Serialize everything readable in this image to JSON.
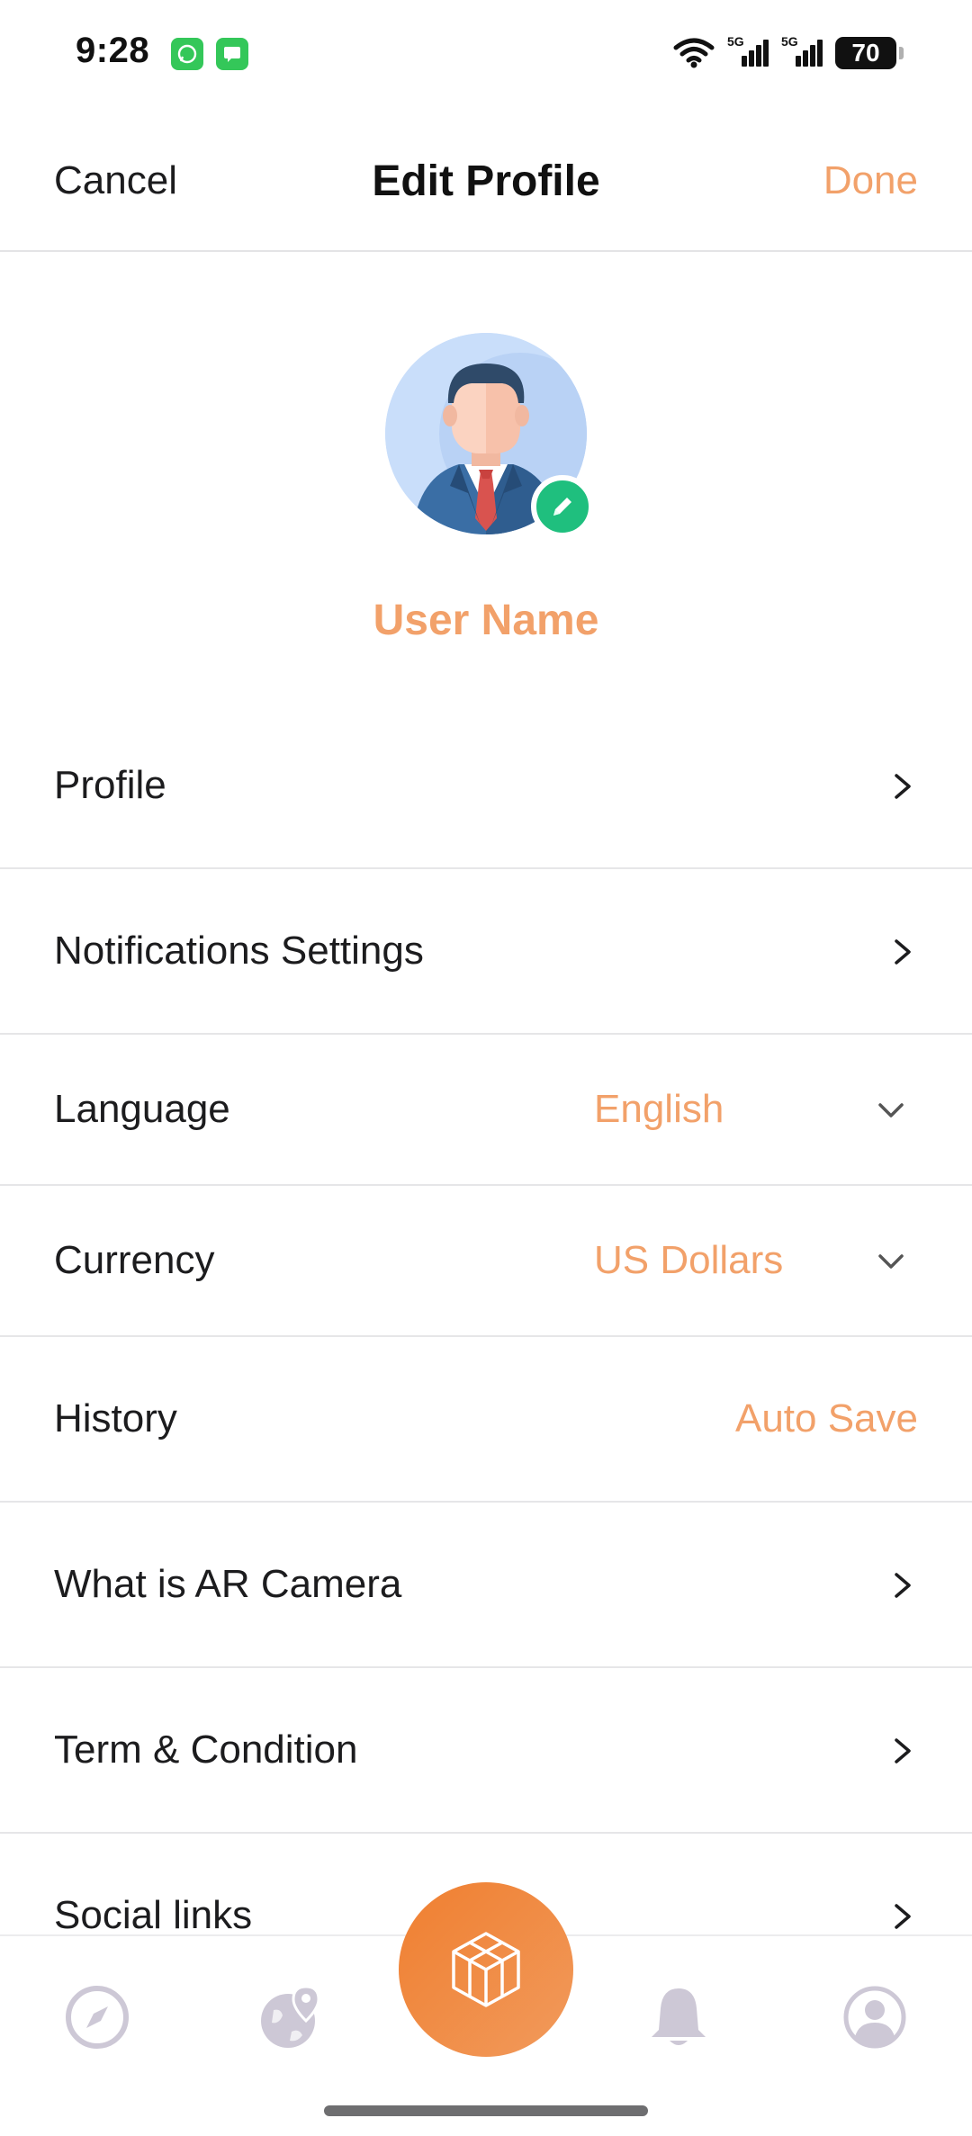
{
  "status_bar": {
    "time": "9:28",
    "network_1": "5G",
    "network_2": "5G",
    "battery": "70"
  },
  "header": {
    "cancel_label": "Cancel",
    "title": "Edit Profile",
    "done_label": "Done"
  },
  "profile": {
    "user_name": "User Name"
  },
  "menu": {
    "profile": "Profile",
    "notifications": "Notifications Settings",
    "language_label": "Language",
    "language_value": "English",
    "currency_label": "Currency",
    "currency_value": "US Dollars",
    "history_label": "History",
    "history_value": "Auto Save",
    "ar_camera": "What is AR Camera",
    "terms": "Term & Condition",
    "social_links": "Social links"
  },
  "tabbar": {
    "items": [
      "compass-icon",
      "globe-pin-icon",
      "ar-cube-icon",
      "bell-icon",
      "user-icon"
    ]
  },
  "colors": {
    "accent": "#f2a16a",
    "fab_start": "#f07f30",
    "fab_end": "#f19a5c",
    "edit_badge": "#1fbf7e",
    "tab_icon": "#cdc8d6"
  }
}
